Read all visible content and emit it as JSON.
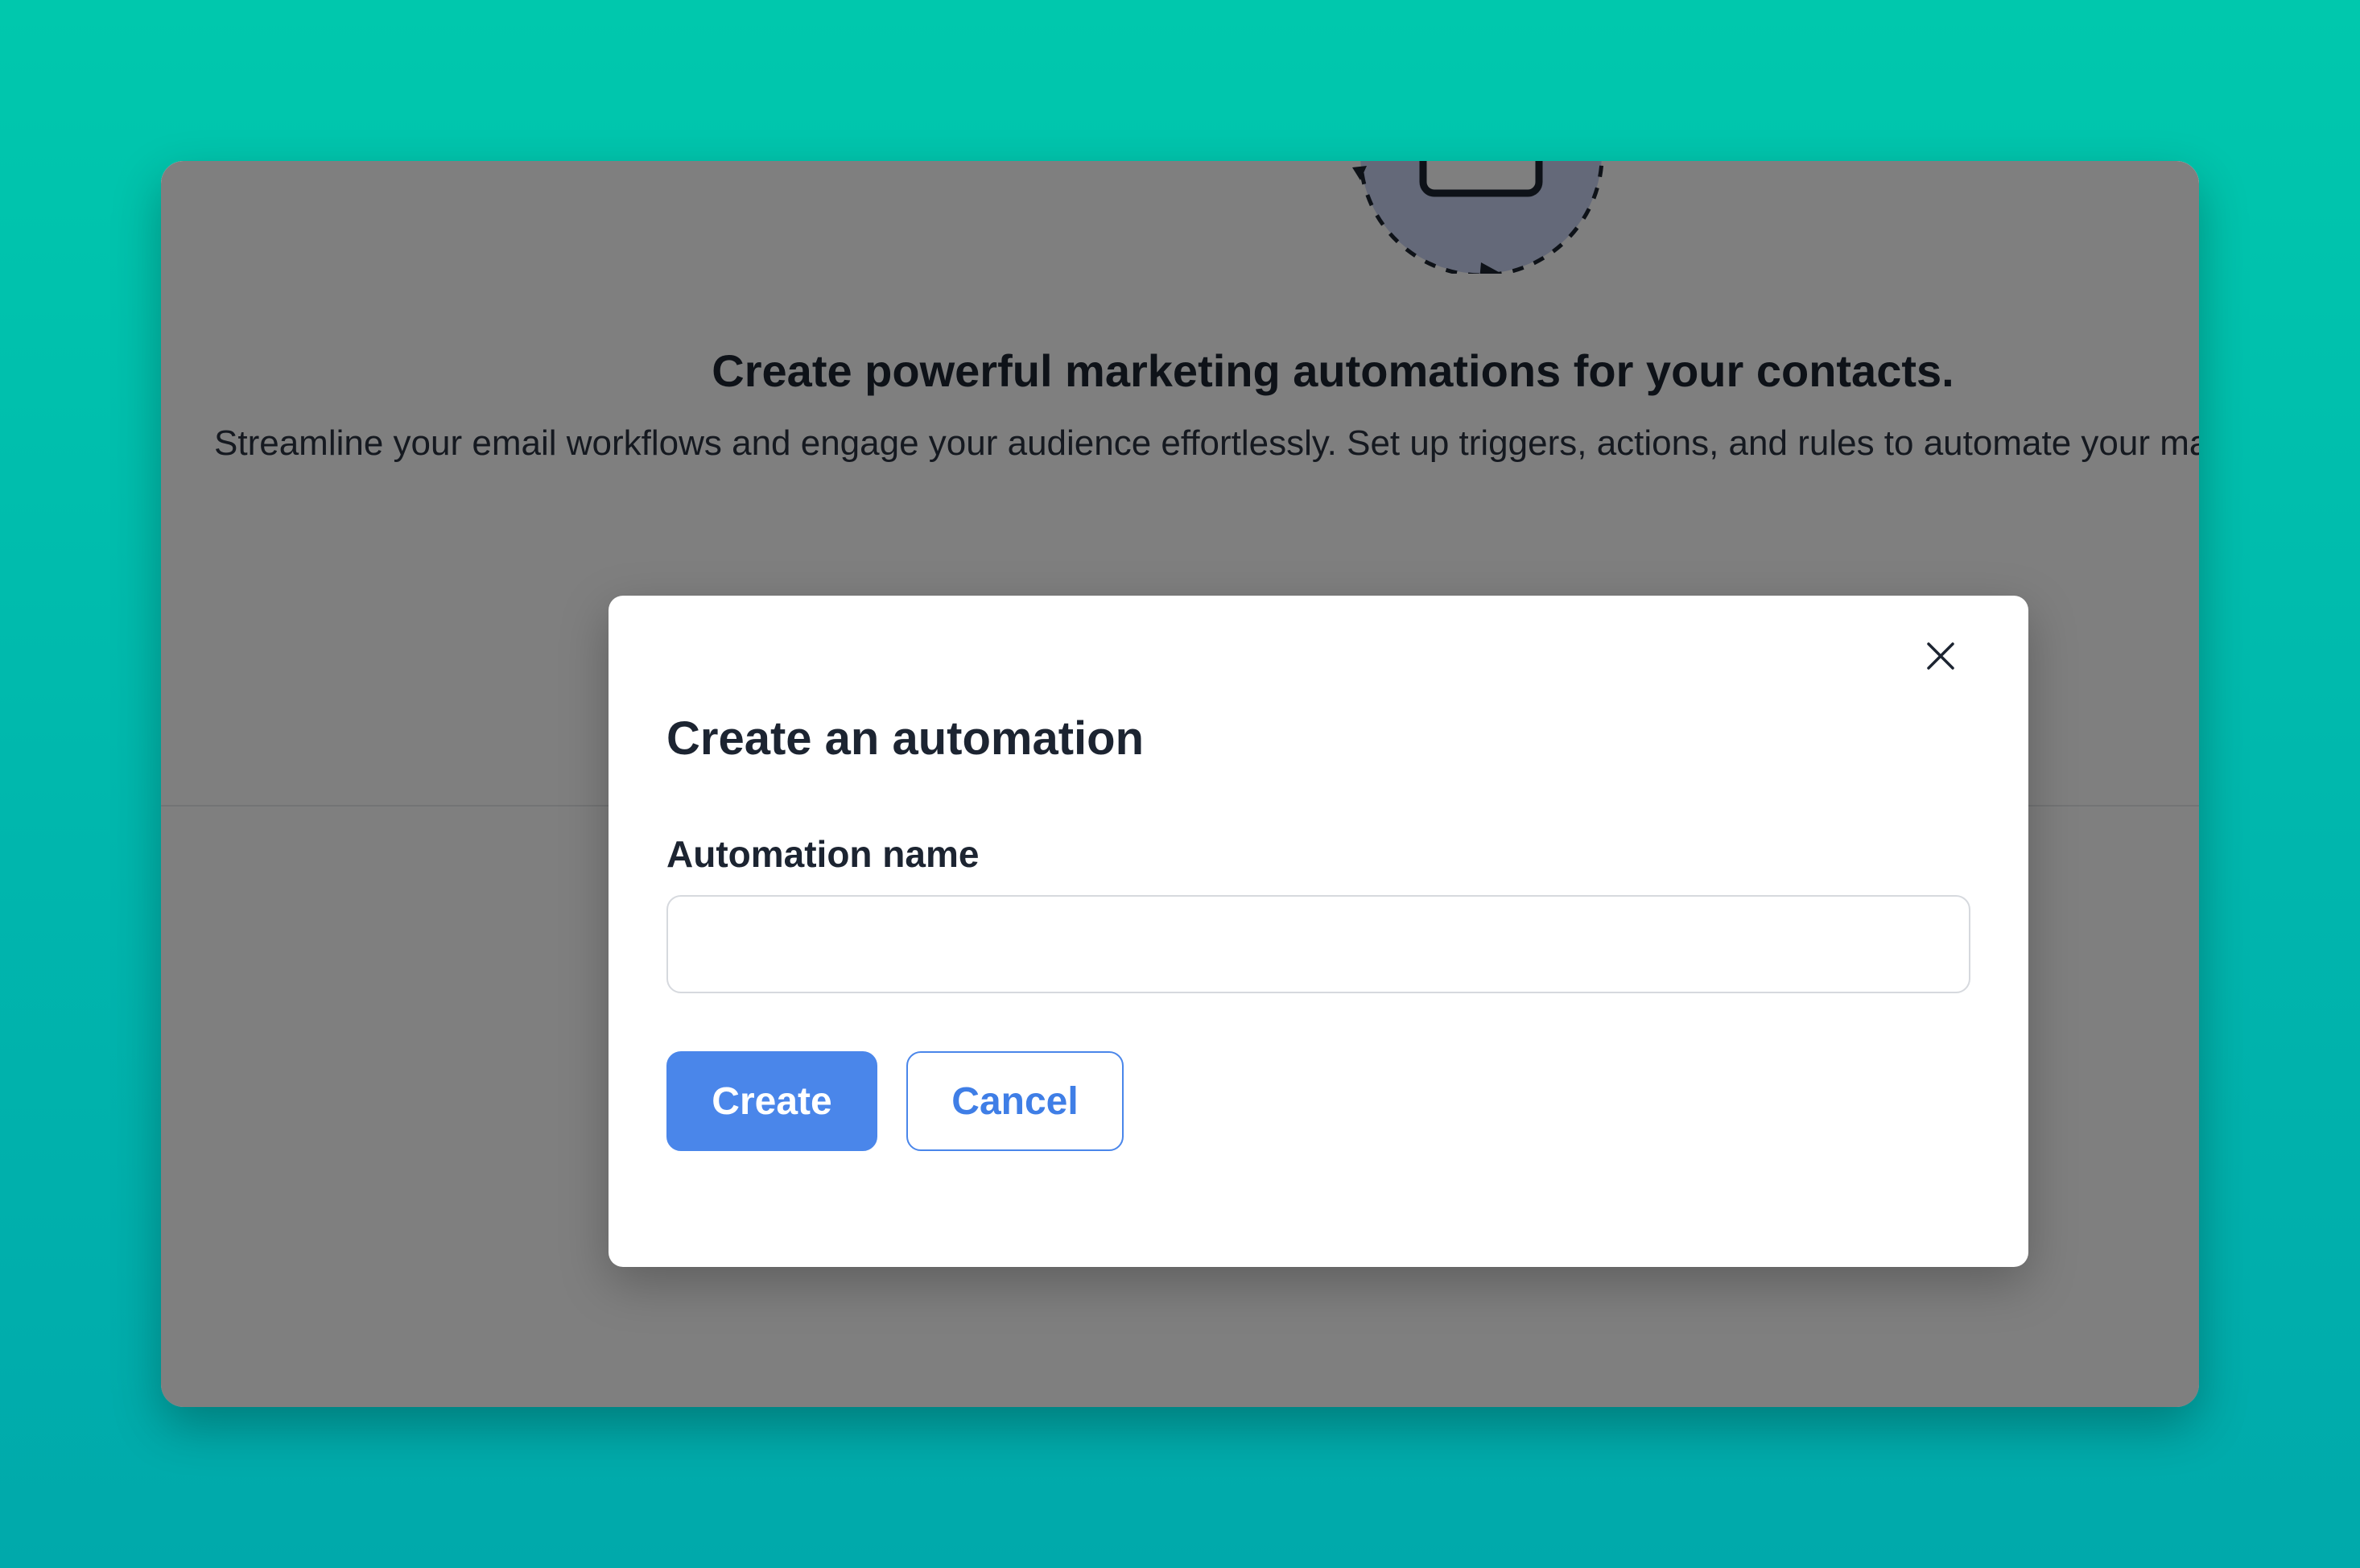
{
  "background": {
    "gradient_colors": [
      "#00c8ad",
      "#00b6ad",
      "#00a9ab"
    ]
  },
  "hero": {
    "headline": "Create powerful marketing automations for your contacts.",
    "description": "Streamline your email workflows and engage your audience effortlessly. Set up triggers, actions, and rules to automate your marketing."
  },
  "modal": {
    "title": "Create an automation",
    "field_label": "Automation name",
    "input_value": "",
    "input_placeholder": "",
    "create_label": "Create",
    "cancel_label": "Cancel",
    "close_icon": "close-icon"
  },
  "colors": {
    "primary": "#4a86ea",
    "text_dark": "#1c2431",
    "overlay": "rgba(0,0,0,0.5)"
  }
}
